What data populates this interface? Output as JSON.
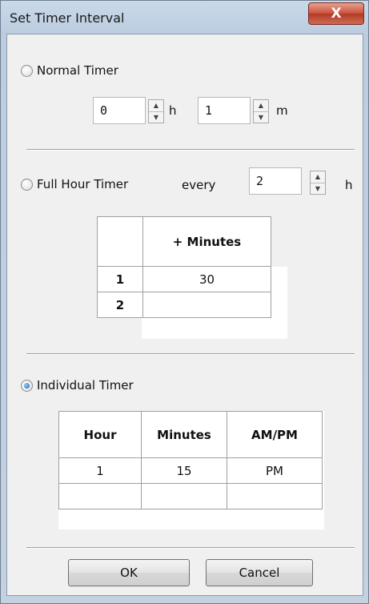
{
  "window": {
    "title": "Set Timer Interval",
    "close_glyph": "X"
  },
  "normal_timer": {
    "label": "Normal Timer",
    "checked": false,
    "hours_value": "0",
    "hours_unit": "h",
    "minutes_value": "1",
    "minutes_unit": "m"
  },
  "full_hour_timer": {
    "label": "Full Hour Timer",
    "checked": false,
    "every_label": "every",
    "every_value": "2",
    "every_unit": "h",
    "table": {
      "header": "+ Minutes",
      "rows": [
        {
          "index": "1",
          "minutes": "30"
        },
        {
          "index": "2",
          "minutes": ""
        }
      ]
    }
  },
  "individual_timer": {
    "label": "Individual Timer",
    "checked": true,
    "table": {
      "headers": [
        "Hour",
        "Minutes",
        "AM/PM"
      ],
      "rows": [
        {
          "hour": "1",
          "minutes": "15",
          "ampm": "PM"
        },
        {
          "hour": "",
          "minutes": "",
          "ampm": ""
        }
      ]
    }
  },
  "buttons": {
    "ok": "OK",
    "cancel": "Cancel"
  }
}
